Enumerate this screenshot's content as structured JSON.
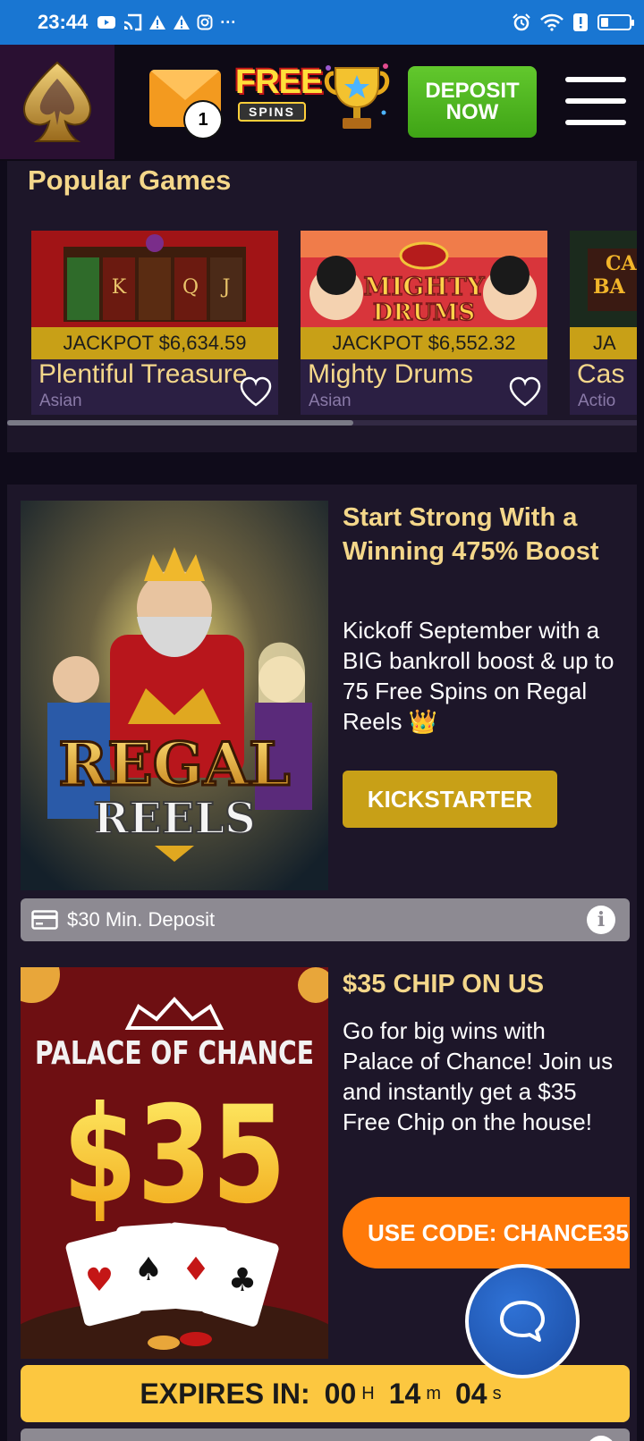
{
  "status_bar": {
    "time": "23:44",
    "left_icons": [
      "youtube-icon",
      "cast-icon",
      "warning-icon",
      "warning-icon",
      "instagram-icon",
      "more-dots-icon"
    ],
    "more": "···",
    "right_icons": [
      "alarm-icon",
      "wifi-icon",
      "alert-icon",
      "battery-icon"
    ],
    "battery_level": 0.25
  },
  "header": {
    "logo": "spade-logo",
    "mail_badge_count": "1",
    "free_spins_top": "FREE",
    "free_spins_bottom": "SPINS",
    "deposit_line1": "DEPOSIT",
    "deposit_line2": "NOW",
    "colors": {
      "deposit": "#4cb520",
      "logo_bg": "#2a1032"
    }
  },
  "popular_games": {
    "title": "Popular Games",
    "games": [
      {
        "jackpot": "JACKPOT $6,634.59",
        "name": "Plentiful Treasure",
        "category": "Asian"
      },
      {
        "jackpot": "JACKPOT $6,552.32",
        "name": "Mighty Drums",
        "category": "Asian"
      },
      {
        "jackpot": "JA",
        "name": "Cas",
        "category": "Actio"
      }
    ],
    "scroll_fraction": 0.55
  },
  "promos": [
    {
      "image_text_1": "REGAL",
      "image_text_2": "REELS",
      "title": "Start Strong With a Winning 475% Boost",
      "description": "Kickoff September with a BIG bankroll boost & up to 75 Free Spins on Regal Reels 👑",
      "button": "KICKSTARTER",
      "min_deposit": "$30 Min. Deposit"
    },
    {
      "image_text_1": "PALACE OF CHANCE",
      "image_text_2": "$35",
      "title": "$35 CHIP ON US",
      "description": "Go for big wins with Palace of Chance! Join us and instantly get a $35 Free Chip on the house!",
      "button": "USE CODE: CHANCE35",
      "expires_label": "EXPIRES IN:",
      "expires": {
        "hours": "00",
        "h": "H",
        "minutes": "14",
        "m": "m",
        "seconds": "04",
        "s": "s"
      }
    }
  ]
}
